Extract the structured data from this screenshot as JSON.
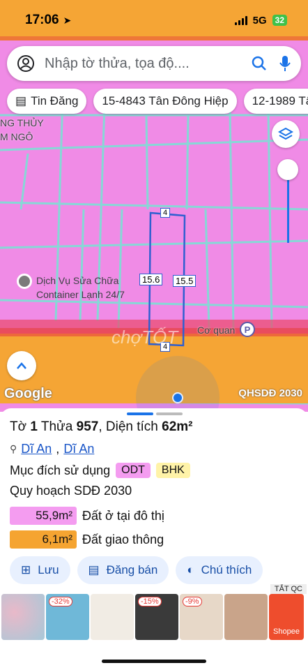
{
  "status": {
    "time": "17:06",
    "network": "5G",
    "battery": "32"
  },
  "search": {
    "placeholder": "Nhập tờ thửa, tọa độ...."
  },
  "chips": [
    {
      "label": "Tin Đăng"
    },
    {
      "label": "15-4843 Tân Đông Hiệp"
    },
    {
      "label": "12-1989 Tâ"
    }
  ],
  "map": {
    "labels": {
      "place1": "NG THỦY",
      "place2": "M NGÔ",
      "poi": "Dịch Vụ Sửa Chữa\nContainer Lạnh 24/7",
      "coquan": "Cơ quan"
    },
    "dims": {
      "top": "4",
      "bottom": "4",
      "left": "15.6",
      "right": "15.5"
    },
    "google": "Google",
    "layer": "QHSDĐ 2030",
    "watermark": "chợTỐT"
  },
  "sheet": {
    "title_pre": "Tờ",
    "sheet_no": "1",
    "parcel_label": "Thửa",
    "parcel_no": "957",
    "area_label": ", Diện tích",
    "area": "62m²",
    "loc1": "Dĩ An",
    "loc2": "Dĩ An",
    "purpose_label": "Mục đích sử dụng",
    "tag1": "ODT",
    "tag2": "BHK",
    "plan_label": "Quy hoạch SDĐ 2030",
    "legend": [
      {
        "value": "55,9m²",
        "label": "Đất ở tại đô thị",
        "color": "#f49cf0"
      },
      {
        "value": "6,1m²",
        "label": "Đất giao thông",
        "color": "#f5a431"
      }
    ],
    "actions": [
      {
        "label": "Lưu"
      },
      {
        "label": "Đăng bán"
      },
      {
        "label": "Chú thích"
      }
    ]
  },
  "ads": {
    "close": "TẮT QC",
    "badge1": "-32%",
    "badge2": "-15%",
    "badge3": "-9%",
    "shopee": "Shopee"
  }
}
